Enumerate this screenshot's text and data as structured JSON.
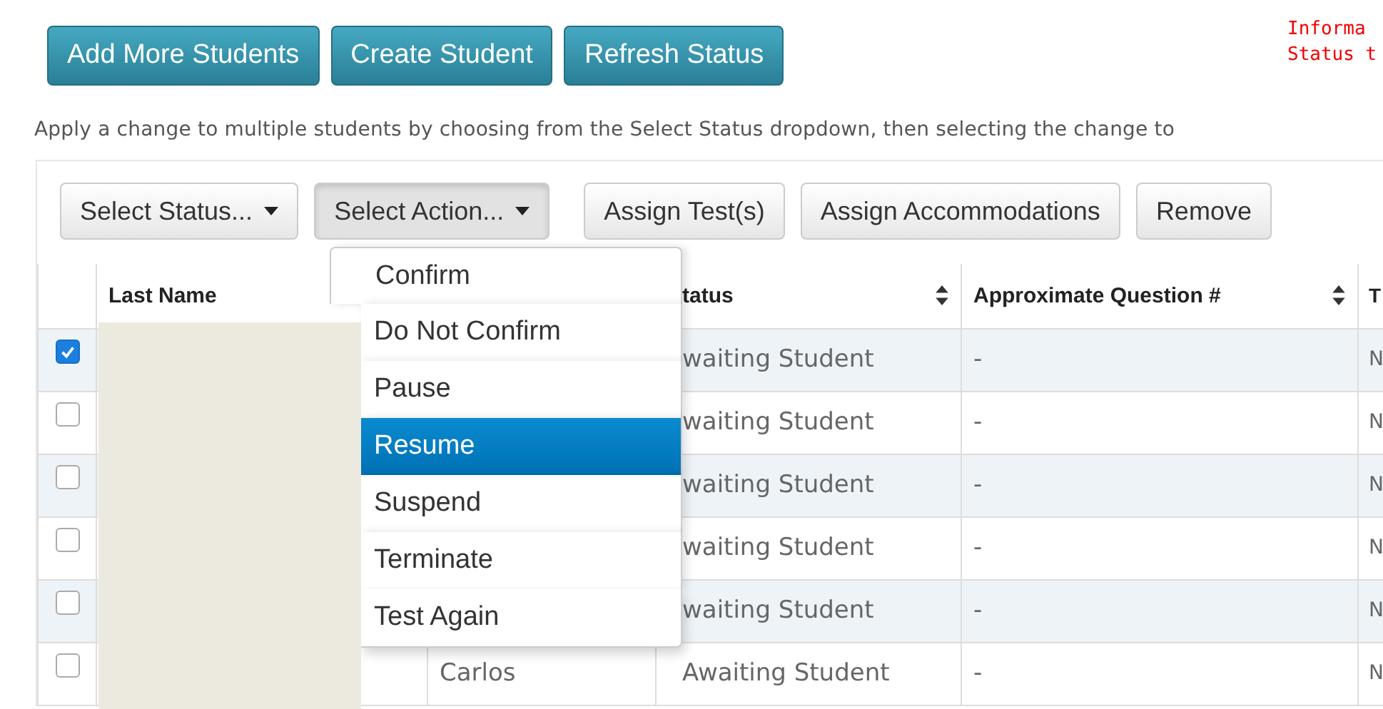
{
  "header_buttons": [
    "Add More Students",
    "Create Student",
    "Refresh Status"
  ],
  "notice": [
    "Informa",
    "Status t"
  ],
  "instructions": "Apply a change to multiple students by choosing from the Select Status dropdown, then selecting the change to",
  "toolbar": [
    {
      "label": "Select Status...",
      "kind": "dropdown",
      "pressed": false
    },
    {
      "label": "Select Action...",
      "kind": "dropdown",
      "pressed": true
    },
    {
      "label": "Assign Test(s)",
      "kind": "button"
    },
    {
      "label": "Assign Accommodations",
      "kind": "button"
    },
    {
      "label": "Remove",
      "kind": "button"
    }
  ],
  "action_menu": [
    {
      "label": "Confirm",
      "selected": false
    },
    {
      "label": "Do Not Confirm",
      "selected": false
    },
    {
      "label": "Pause",
      "selected": false
    },
    {
      "label": "Resume",
      "selected": true
    },
    {
      "label": "Suspend",
      "selected": false
    },
    {
      "label": "Terminate",
      "selected": false
    },
    {
      "label": "Test Again",
      "selected": false
    }
  ],
  "table": {
    "columns": [
      {
        "label": "Last Name",
        "sortable": false
      },
      {
        "label": "tatus",
        "sortable": true
      },
      {
        "label": "Approximate Question #",
        "sortable": true
      },
      {
        "label": "T",
        "sortable": false
      }
    ],
    "rows": [
      {
        "checked": true,
        "status": "waiting Student",
        "approx": "-",
        "column_5": "N"
      },
      {
        "checked": false,
        "status": "waiting Student",
        "approx": "-",
        "column_5": "N"
      },
      {
        "checked": false,
        "status": "waiting Student",
        "approx": "-",
        "column_5": "N"
      },
      {
        "checked": false,
        "status": "waiting Student",
        "approx": "-",
        "column_5": "N"
      },
      {
        "checked": false,
        "status": "waiting Student",
        "approx": "-",
        "column_5": "N"
      },
      {
        "checked": false,
        "first_name": "Carlos",
        "status": "Awaiting Student",
        "approx": "-",
        "column_5": "N"
      }
    ]
  }
}
